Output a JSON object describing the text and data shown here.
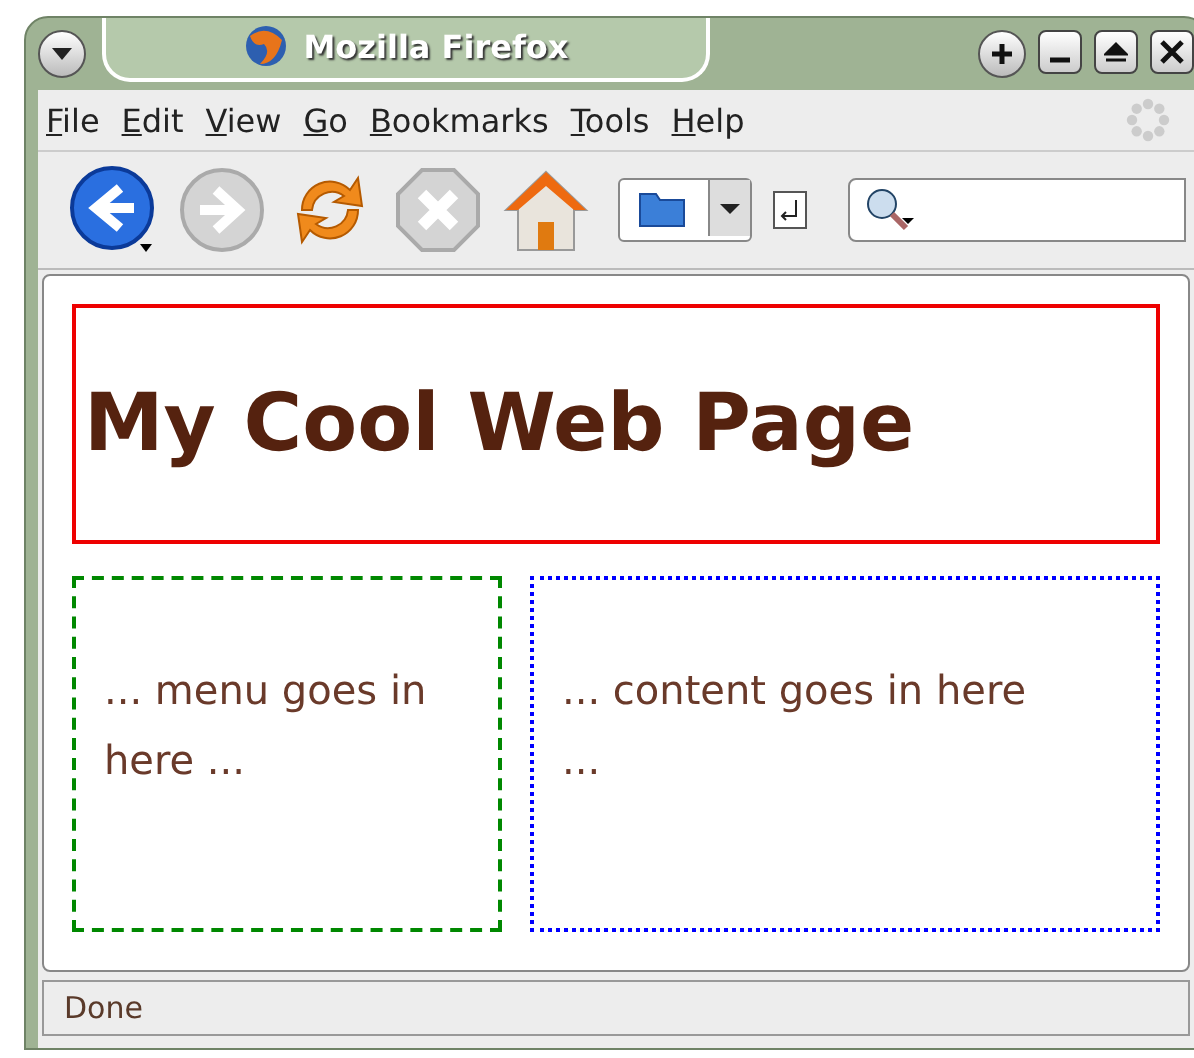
{
  "window": {
    "title": "Mozilla Firefox"
  },
  "menu": [
    {
      "label": "File"
    },
    {
      "label": "Edit"
    },
    {
      "label": "View"
    },
    {
      "label": "Go"
    },
    {
      "label": "Bookmarks"
    },
    {
      "label": "Tools"
    },
    {
      "label": "Help"
    }
  ],
  "toolbar": [
    {
      "kind": "back",
      "disabled": false
    },
    {
      "kind": "forward",
      "disabled": true
    },
    {
      "kind": "reload",
      "disabled": false
    },
    {
      "kind": "stop",
      "disabled": true
    },
    {
      "kind": "home",
      "disabled": false
    }
  ],
  "page": {
    "heading": "My Cool Web Page",
    "menu_text": "... menu goes in here ...",
    "content_text": "... content goes in here ..."
  },
  "status_bar": {
    "text": "Done"
  }
}
